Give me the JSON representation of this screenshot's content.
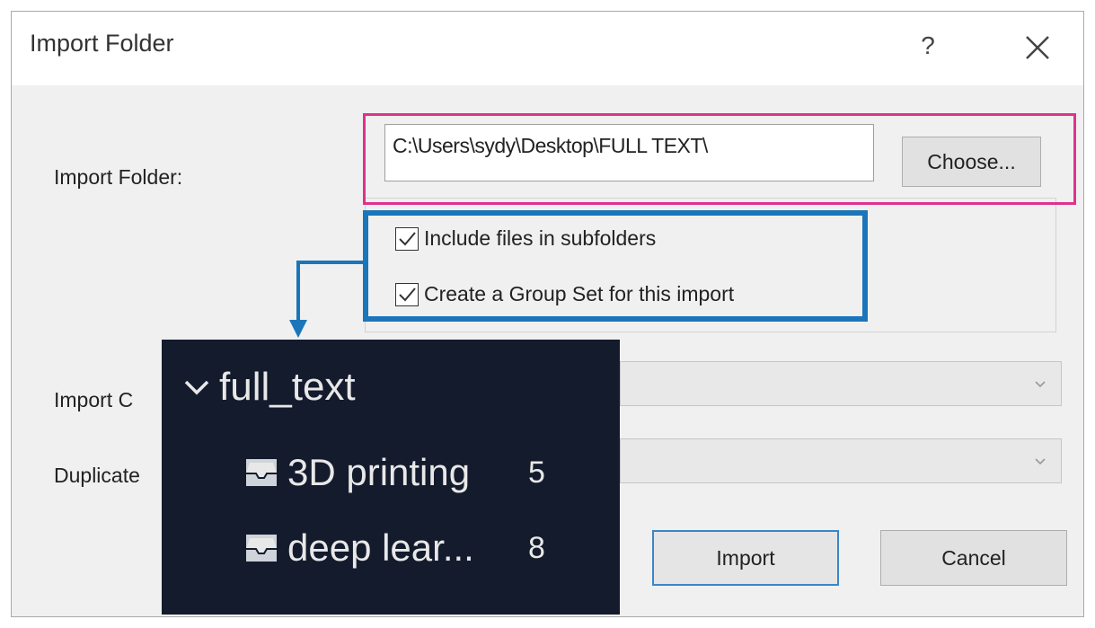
{
  "dialog": {
    "title": "Import Folder",
    "help_label": "?"
  },
  "form": {
    "import_folder_label": "Import Folder:",
    "folder_path": "C:\\Users\\sydy\\Desktop\\FULL TEXT\\",
    "choose_label": "Choose...",
    "include_subfolders_label": "Include files in subfolders",
    "include_subfolders_checked": true,
    "create_group_set_label": "Create a Group Set for this import",
    "create_group_set_checked": true,
    "import_option_label": "Import C",
    "duplicate_label": "Duplicate"
  },
  "buttons": {
    "import": "Import",
    "cancel": "Cancel"
  },
  "tree": {
    "root": "full_text",
    "items": [
      {
        "name": "3D printing",
        "count": "5"
      },
      {
        "name": "deep lear...",
        "count": "8"
      }
    ]
  },
  "colors": {
    "highlight_pink": "#e0318c",
    "highlight_blue": "#1b75bb",
    "tree_panel_bg": "#141b2d"
  },
  "icons": [
    "help-icon",
    "close-icon",
    "checkmark-icon",
    "chevron-down-icon",
    "tray-icon"
  ]
}
